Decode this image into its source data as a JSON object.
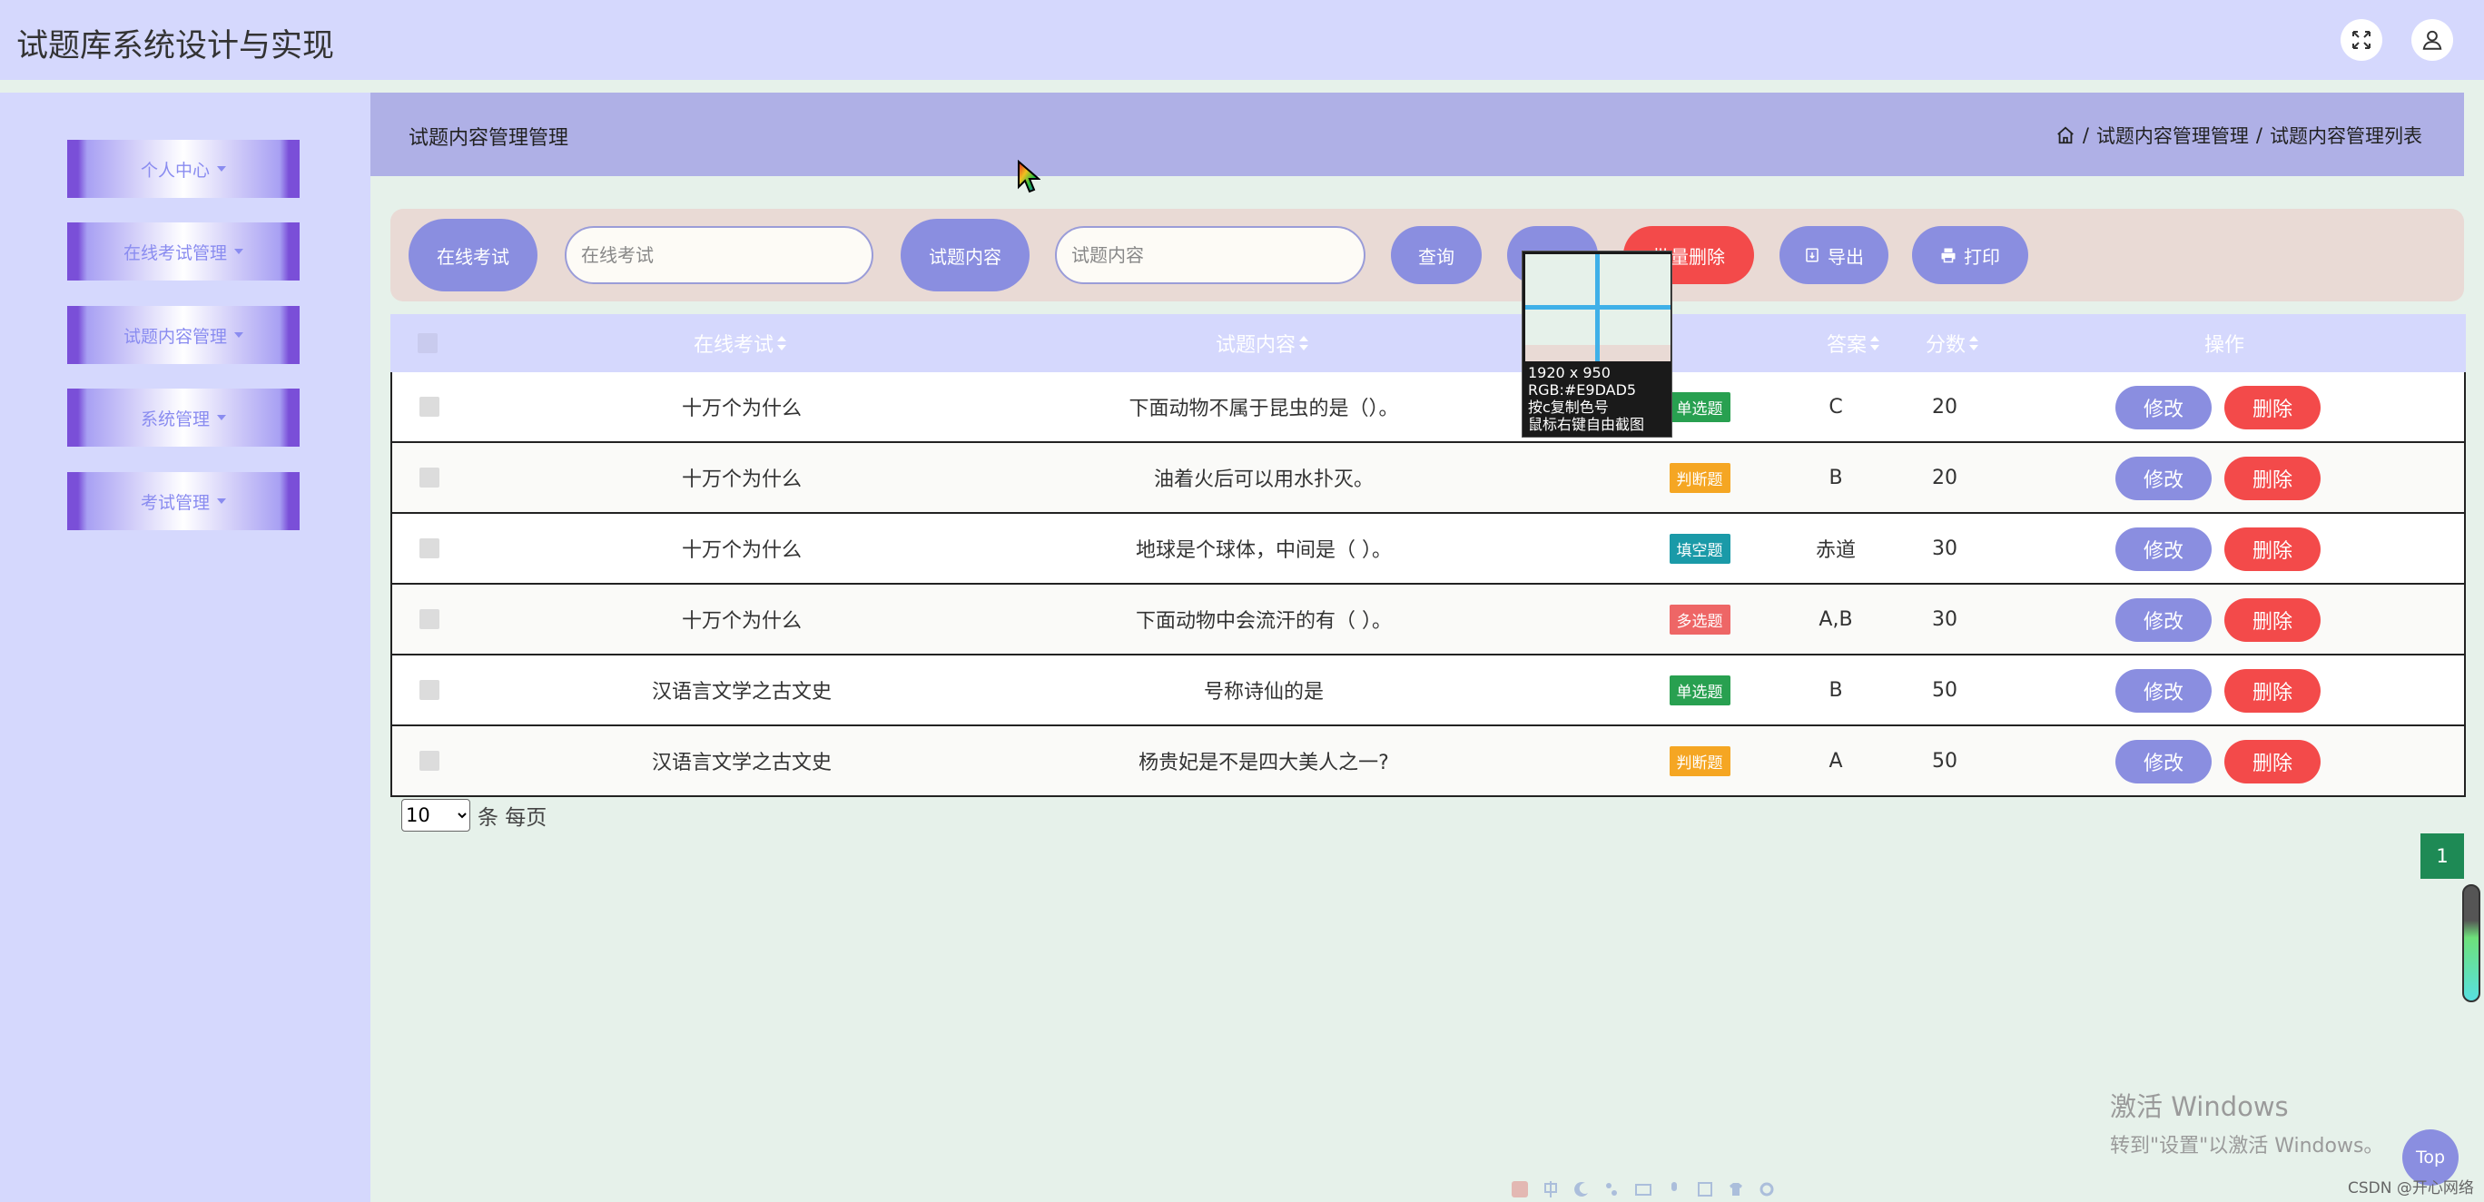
{
  "app": {
    "title": "试题库系统设计与实现"
  },
  "header_icons": {
    "fullscreen": "fullscreen-icon",
    "user": "user-icon"
  },
  "sidebar": {
    "items": [
      {
        "label": "个人中心"
      },
      {
        "label": "在线考试管理"
      },
      {
        "label": "试题内容管理"
      },
      {
        "label": "系统管理"
      },
      {
        "label": "考试管理"
      }
    ]
  },
  "page_header": {
    "title": "试题内容管理管理",
    "breadcrumb": [
      "试题内容管理管理",
      "试题内容管理列表"
    ],
    "separator": "/"
  },
  "search": {
    "exam_label": "在线考试",
    "exam_placeholder": "在线考试",
    "content_label": "试题内容",
    "content_placeholder": "试题内容",
    "query_button": "查询",
    "add_button": "",
    "batch_delete_button": "批量删除",
    "export_button": "导出",
    "print_button": "打印"
  },
  "table": {
    "columns": [
      "在线考试",
      "试题内容",
      "",
      "答案",
      "分数",
      "操作"
    ],
    "edit_label": "修改",
    "delete_label": "删除",
    "rows": [
      {
        "exam": "十万个为什么",
        "content": "下面动物不属于昆虫的是（）。",
        "type": "单选题",
        "type_color": "#28a050",
        "answer": "C",
        "score": "20"
      },
      {
        "exam": "十万个为什么",
        "content": "油着火后可以用水扑灭。",
        "type": "判断题",
        "type_color": "#f5a623",
        "answer": "B",
        "score": "20"
      },
      {
        "exam": "十万个为什么",
        "content": "地球是个球体，中间是（ ）。",
        "type": "填空题",
        "type_color": "#1a9aa8",
        "answer": "赤道",
        "score": "30"
      },
      {
        "exam": "十万个为什么",
        "content": "下面动物中会流汗的有（ ）。",
        "type": "多选题",
        "type_color": "#ee6666",
        "answer": "A,B",
        "score": "30"
      },
      {
        "exam": "汉语言文学之古文史",
        "content": "号称诗仙的是",
        "type": "单选题",
        "type_color": "#28a050",
        "answer": "B",
        "score": "50"
      },
      {
        "exam": "汉语言文学之古文史",
        "content": "杨贵妃是不是四大美人之一?",
        "type": "判断题",
        "type_color": "#f5a623",
        "answer": "A",
        "score": "50"
      }
    ]
  },
  "pagination": {
    "page_size": "10",
    "page_size_suffix": "条 每页",
    "current_page": "1"
  },
  "back_to_top": "Top",
  "color_picker": {
    "size": "1920 x 950",
    "rgb": "RGB:#E9DAD5",
    "hint1": "按c复制色号",
    "hint2": "鼠标右键自由截图"
  },
  "watermark": {
    "line1": "激活 Windows",
    "line2": "转到\"设置\"以激活 Windows。"
  },
  "credit": "CSDN @开心网络"
}
